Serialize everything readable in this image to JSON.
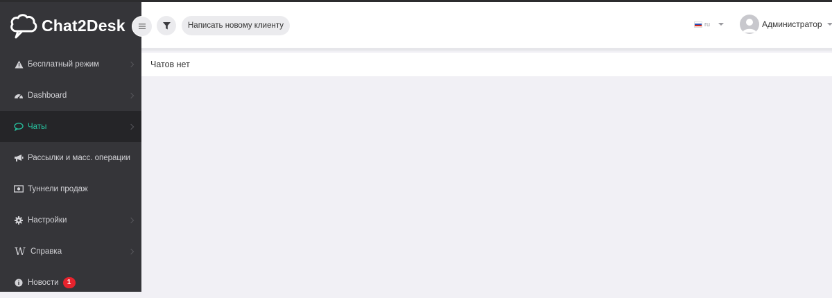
{
  "brand": {
    "name": "Chat2Desk"
  },
  "sidebar": {
    "items": [
      {
        "label": "Бесплатный режим",
        "icon": "warning-icon"
      },
      {
        "label": "Dashboard",
        "icon": "dashboard-icon"
      },
      {
        "label": "Чаты",
        "icon": "chat-bubble-icon",
        "active": true
      },
      {
        "label": "Рассылки и масс. операции",
        "icon": "megaphone-icon"
      },
      {
        "label": "Туннели продаж",
        "icon": "money-icon"
      },
      {
        "label": "Настройки",
        "icon": "gear-icon"
      },
      {
        "label": "Справка",
        "icon": "wikipedia-icon"
      },
      {
        "label": "Новости",
        "icon": "info-icon",
        "badge": "1"
      }
    ]
  },
  "header": {
    "new_client_label": "Написать новому клиенту",
    "language": "ru",
    "user_name": "Администратор"
  },
  "main": {
    "empty_text": "Чатов нет"
  },
  "colors": {
    "sidebar_bg": "#353539",
    "active_item_bg": "#252528",
    "accent": "#27c3a0",
    "badge": "#e6232d"
  }
}
